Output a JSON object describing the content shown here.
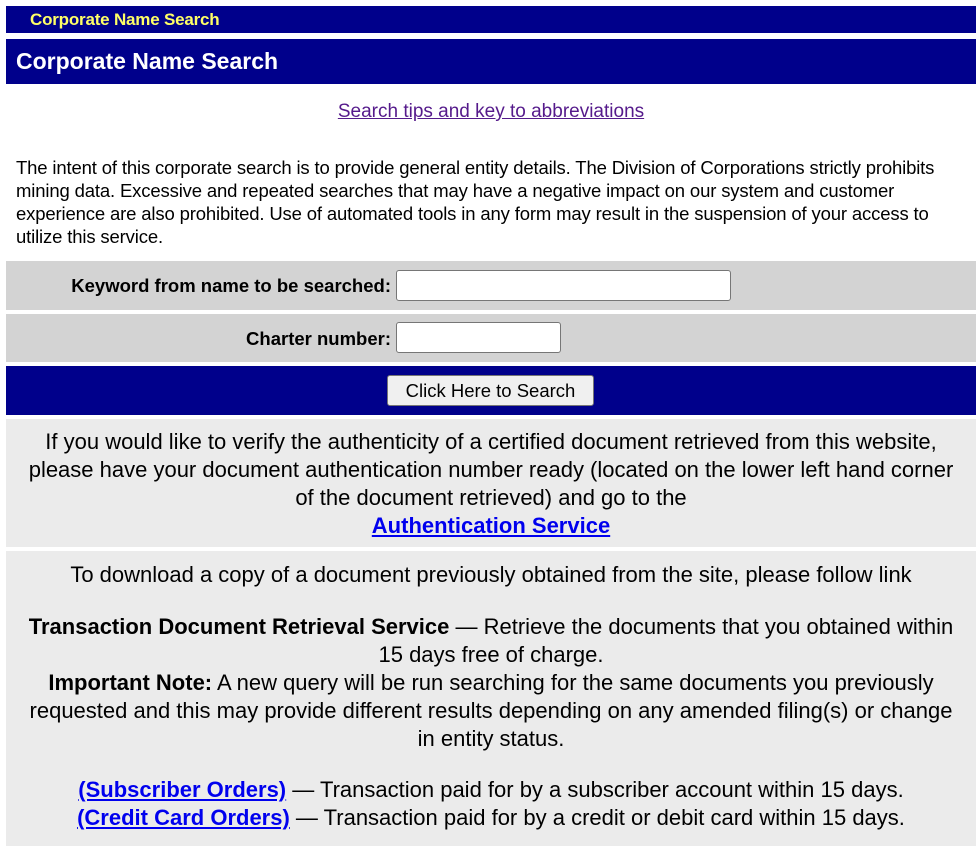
{
  "top_bar": {
    "title": "Corporate Name Search"
  },
  "header": {
    "title": "Corporate Name Search"
  },
  "tips_link": "Search tips and key to abbreviations",
  "intent_text": "The intent of this corporate search is to provide general entity details. The Division of Corporations strictly prohibits mining data. Excessive and repeated searches that may have a negative impact on our system and customer experience are also prohibited. Use of automated tools in any form may result in the suspension of your access to utilize this service.",
  "form": {
    "keyword_label": "Keyword from name to be searched:",
    "keyword_value": "",
    "charter_label": "Charter number:",
    "charter_value": "",
    "search_button": "Click Here to Search"
  },
  "auth": {
    "text": "If you would like to verify the authenticity of a certified document retrieved from this website, please have your document authentication number ready (located on the lower left hand corner of the document retrieved) and go to the",
    "link": "Authentication Service"
  },
  "download": {
    "intro": "To download a copy of a document previously obtained from the site, please follow link",
    "retrieval_title": "Transaction Document Retrieval Service",
    "retrieval_desc": " — Retrieve the documents that you obtained within 15 days free of charge.",
    "note_label": "Important Note:",
    "note_text": " A new query will be run searching for the same documents you previously requested and this may provide different results depending on any amended filing(s) or change in entity status.",
    "subscriber_link": "(Subscriber Orders)",
    "subscriber_desc": " — Transaction paid for by a subscriber account within 15 days.",
    "credit_link": "(Credit Card Orders)",
    "credit_desc": " — Transaction paid for by a credit or debit card within 15 days."
  },
  "colors": {
    "bar_blue": "#00008b",
    "top_title_yellow": "#ffff66",
    "form_gray": "#d3d3d3",
    "panel_gray": "#ebebeb",
    "link_blue": "#0000ee",
    "visited_purple": "#551a8b"
  }
}
